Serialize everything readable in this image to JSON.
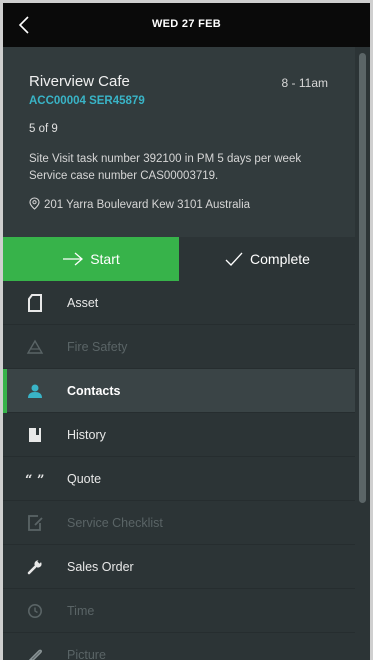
{
  "topbar": {
    "title": "WED 27 FEB",
    "back_icon": "chevron-left-icon"
  },
  "job": {
    "customer": "Riverview Cafe",
    "time_range": "8 - 11am",
    "refs": "ACC00004 SER45879",
    "position": "5 of 9",
    "description": "Site Visit task number 392100 in PM 5 days per week Service case number CAS00003719.",
    "address": "201 Yarra Boulevard Kew 3101 Australia"
  },
  "actions": {
    "start_label": "Start",
    "complete_label": "Complete",
    "start_color": "#37b34a"
  },
  "menu": {
    "items": [
      {
        "label": "Asset",
        "icon": "asset-icon",
        "enabled": true
      },
      {
        "label": "Fire Safety",
        "icon": "fire-safety-icon",
        "enabled": false
      },
      {
        "label": "Contacts",
        "icon": "contacts-icon",
        "enabled": true,
        "selected": true
      },
      {
        "label": "History",
        "icon": "history-icon",
        "enabled": true
      },
      {
        "label": "Quote",
        "icon": "quote-icon",
        "enabled": true
      },
      {
        "label": "Service Checklist",
        "icon": "checklist-icon",
        "enabled": false
      },
      {
        "label": "Sales Order",
        "icon": "wrench-icon",
        "enabled": true
      },
      {
        "label": "Time",
        "icon": "clock-icon",
        "enabled": false
      },
      {
        "label": "Picture",
        "icon": "picture-icon",
        "enabled": false
      }
    ]
  },
  "colors": {
    "accent_green": "#37b34a",
    "accent_blue": "#39b4c7",
    "background": "#2c3436",
    "topbar": "#0a0a0a"
  }
}
